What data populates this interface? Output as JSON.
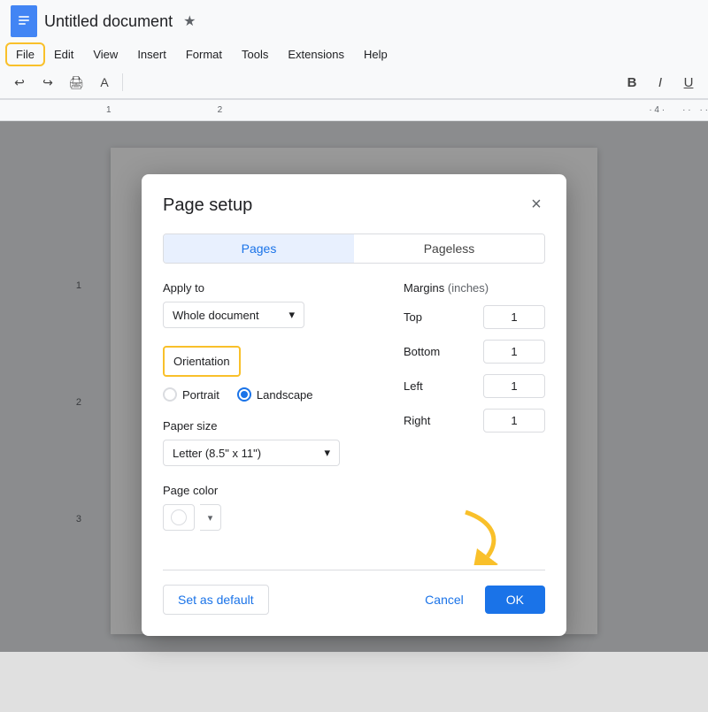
{
  "appBar": {
    "docTitle": "Untitled document",
    "starIcon": "★",
    "menuItems": [
      {
        "id": "file",
        "label": "File",
        "highlighted": true
      },
      {
        "id": "edit",
        "label": "Edit",
        "highlighted": false
      },
      {
        "id": "view",
        "label": "View",
        "highlighted": false
      },
      {
        "id": "insert",
        "label": "Insert",
        "highlighted": false
      },
      {
        "id": "format",
        "label": "Format",
        "highlighted": false
      },
      {
        "id": "tools",
        "label": "Tools",
        "highlighted": false
      },
      {
        "id": "extensions",
        "label": "Extensions",
        "highlighted": false
      },
      {
        "id": "help",
        "label": "Help",
        "highlighted": false
      }
    ],
    "toolbar": {
      "bold": "B",
      "italic": "I",
      "underline": "U"
    }
  },
  "dialog": {
    "title": "Page setup",
    "closeLabel": "×",
    "tabs": [
      {
        "id": "pages",
        "label": "Pages",
        "active": true
      },
      {
        "id": "pageless",
        "label": "Pageless",
        "active": false
      }
    ],
    "applyTo": {
      "label": "Apply to",
      "value": "Whole document",
      "dropdownArrow": "▾"
    },
    "orientation": {
      "sectionLabel": "Orientation",
      "options": [
        {
          "id": "portrait",
          "label": "Portrait",
          "selected": false
        },
        {
          "id": "landscape",
          "label": "Landscape",
          "selected": true
        }
      ]
    },
    "paperSize": {
      "label": "Paper size",
      "value": "Letter (8.5\" x 11\")",
      "dropdownArrow": "▾"
    },
    "pageColor": {
      "label": "Page color"
    },
    "margins": {
      "title": "Margins",
      "unit": "(inches)",
      "fields": [
        {
          "id": "top",
          "label": "Top",
          "value": "1"
        },
        {
          "id": "bottom",
          "label": "Bottom",
          "value": "1"
        },
        {
          "id": "left",
          "label": "Left",
          "value": "1"
        },
        {
          "id": "right",
          "label": "Right",
          "value": "1"
        }
      ]
    },
    "buttons": {
      "setDefault": "Set as default",
      "cancel": "Cancel",
      "ok": "OK"
    }
  }
}
